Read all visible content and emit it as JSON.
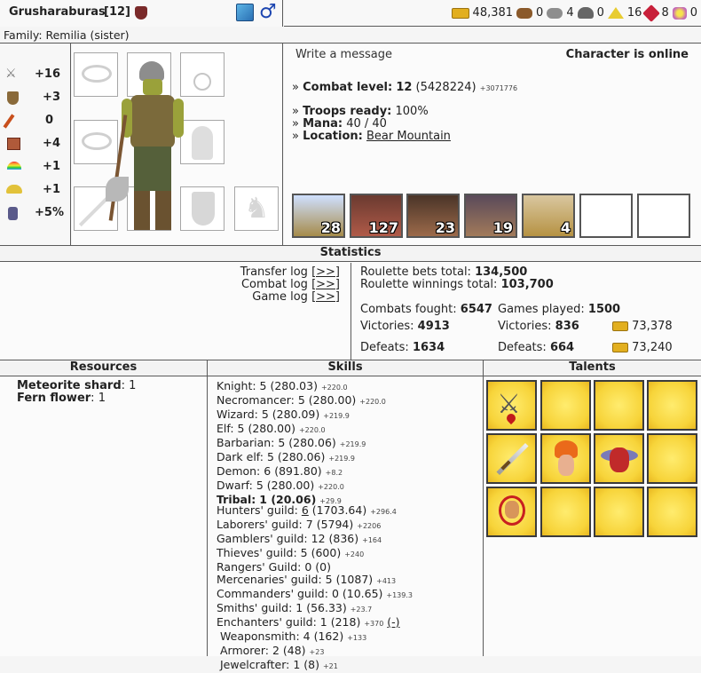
{
  "header": {
    "name": "Grusharaburas",
    "level": "[12]"
  },
  "currency": [
    {
      "icon": "gold-icon",
      "value": "48,381",
      "color": "#d5a21a"
    },
    {
      "icon": "wood-icon",
      "value": "0",
      "color": "#8b5a2b"
    },
    {
      "icon": "ore-icon",
      "value": "4",
      "color": "#8e8e8e"
    },
    {
      "icon": "mercury-icon",
      "value": "0",
      "color": "#666666"
    },
    {
      "icon": "sulfur-icon",
      "value": "16",
      "color": "#e8cc30"
    },
    {
      "icon": "crystal-icon",
      "value": "8",
      "color": "#c8203a"
    },
    {
      "icon": "gems-icon",
      "value": "0",
      "color": "#c46ab8"
    }
  ],
  "family": "Family: Remilia (sister)",
  "stats": [
    {
      "icon": "attack-icon",
      "value": "+16"
    },
    {
      "icon": "defense-icon",
      "value": "+3"
    },
    {
      "icon": "spellpower-icon",
      "value": "0"
    },
    {
      "icon": "knowledge-icon",
      "value": "+4"
    },
    {
      "icon": "luck-icon",
      "value": "+1"
    },
    {
      "icon": "morale-icon",
      "value": "+1"
    },
    {
      "icon": "initiative-icon",
      "value": "+5%"
    }
  ],
  "info": {
    "write_message": "Write a message",
    "online": "Character is online",
    "combat_label": "Combat level:",
    "combat_value": "12",
    "combat_exp": "(5428224)",
    "combat_extra": "+3071776",
    "troops_label": "Troops ready:",
    "troops_value": "100%",
    "mana_label": "Mana:",
    "mana_value": "40 / 40",
    "location_label": "Location:",
    "location_value": "Bear Mountain",
    "bullet": "»"
  },
  "troops": [
    {
      "name": "treant",
      "count": "28"
    },
    {
      "name": "minotaur",
      "count": "127"
    },
    {
      "name": "bear-rider",
      "count": "23"
    },
    {
      "name": "ogre",
      "count": "19"
    },
    {
      "name": "wyvern",
      "count": "4"
    },
    {
      "name": "empty",
      "count": ""
    },
    {
      "name": "empty",
      "count": ""
    }
  ],
  "statistics": {
    "title": "Statistics",
    "transfer_log": "Transfer log",
    "combat_log": "Combat log",
    "game_log": "Game log",
    "link": "[>>]",
    "roulette_bets_label": "Roulette bets total:",
    "roulette_bets_value": "134,500",
    "roulette_win_label": "Roulette winnings total:",
    "roulette_win_value": "103,700",
    "combats_label": "Combats fought:",
    "combats_value": "6547",
    "victories_label": "Victories:",
    "victories_value": "4913",
    "defeats_label": "Defeats:",
    "defeats_value": "1634",
    "games_label": "Games played:",
    "games_value": "1500",
    "g_victories_value": "836",
    "g_defeats_value": "664",
    "gold_won": "73,378",
    "gold_lost": "73,240"
  },
  "resources": {
    "title": "Resources",
    "items": [
      {
        "name": "Meteorite shard",
        "count": "1"
      },
      {
        "name": "Fern flower",
        "count": "1"
      }
    ]
  },
  "skills": {
    "title": "Skills",
    "factions": [
      {
        "name": "Knight:",
        "value": "5 (280.03)",
        "extra": "+220.0"
      },
      {
        "name": "Necromancer:",
        "value": "5 (280.00)",
        "extra": "+220.0"
      },
      {
        "name": "Wizard:",
        "value": "5 (280.09)",
        "extra": "+219.9"
      },
      {
        "name": "Elf:",
        "value": "5 (280.00)",
        "extra": "+220.0"
      },
      {
        "name": "Barbarian:",
        "value": "5 (280.06)",
        "extra": "+219.9"
      },
      {
        "name": "Dark elf:",
        "value": "5 (280.06)",
        "extra": "+219.9"
      },
      {
        "name": "Demon:",
        "value": "6 (891.80)",
        "extra": "+8.2"
      },
      {
        "name": "Dwarf:",
        "value": "5 (280.00)",
        "extra": "+220.0"
      },
      {
        "name": "Tribal:",
        "value": "1 (20.06)",
        "extra": "+29.9"
      }
    ],
    "guilds": [
      {
        "name": "Hunters' guild:",
        "pre": "",
        "link": "6",
        "value": " (1703.64)",
        "extra": "+296.4"
      },
      {
        "name": "Laborers' guild:",
        "pre": "7 (5794)",
        "link": "",
        "value": "",
        "extra": "+2206"
      },
      {
        "name": "Gamblers' guild:",
        "pre": "12 (836)",
        "link": "",
        "value": "",
        "extra": "+164"
      },
      {
        "name": "Thieves' guild:",
        "pre": "5 (600)",
        "link": "",
        "value": "",
        "extra": "+240"
      },
      {
        "name": "Rangers' Guild:",
        "pre": "0 (0)",
        "link": "",
        "value": "",
        "extra": ""
      },
      {
        "name": "Mercenaries' guild:",
        "pre": "5 (1087)",
        "link": "",
        "value": "",
        "extra": "+413"
      },
      {
        "name": "Commanders' guild:",
        "pre": "0 (10.65)",
        "link": "",
        "value": "",
        "extra": "+139.3"
      },
      {
        "name": "Smiths' guild:",
        "pre": "1 (56.33)",
        "link": "",
        "value": "",
        "extra": "+23.7"
      },
      {
        "name": "Enchanters' guild:",
        "pre": "1 (218)",
        "link": "",
        "value": "",
        "extra": "+370"
      }
    ],
    "enchant_link": "(-)",
    "crafts": [
      {
        "name": "Weaponsmith:",
        "value": "4 (162)",
        "extra": "+133"
      },
      {
        "name": "Armorer:",
        "value": "2 (48)",
        "extra": "+23"
      },
      {
        "name": "Jewelcrafter:",
        "value": "1 (8)",
        "extra": "+21"
      }
    ]
  },
  "talents": {
    "title": "Talents"
  }
}
